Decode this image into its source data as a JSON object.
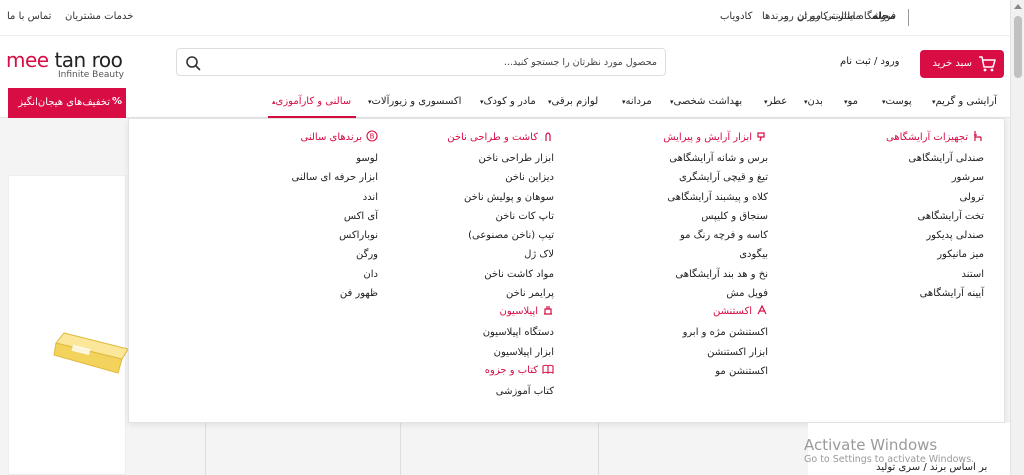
{
  "topbar": {
    "store_title": "فروشگاه اینترنتی مو تن رو",
    "magazine": "مجله",
    "user_content": "مطالب کاربران",
    "brands": "برندها",
    "cadoyab": "کادویاب",
    "customer_service": "خدمات مشتریان",
    "contact": "تماس با ما"
  },
  "header": {
    "logo_text": "tan roo",
    "logo_mee": "mee",
    "logo_sub": "Infinite Beauty",
    "search_placeholder": "محصول مورد نظرتان را جستجو کنید...",
    "login": "ورود / ثبت نام",
    "cart": "سبد خرید"
  },
  "nav": {
    "items": [
      "آرایشی و گریم",
      "پوست",
      "مو",
      "بدن",
      "عطر",
      "بهداشت شخصی",
      "مردانه",
      "لوازم برقی",
      "مادر و کودک",
      "اکسسوری و زیورآلات",
      "سالنی و کارآموزی"
    ],
    "deals": "تخفیف‌های هیجان‌انگیز",
    "deals_pct": "%"
  },
  "mega": {
    "columns": [
      {
        "groups": [
          {
            "head": "تجهیزات آرایشگاهی",
            "icon": "chair-icon",
            "links": [
              "صندلی آرایشگاهی",
              "سرشور",
              "ترولی",
              "تخت آرایشگاهی",
              "صندلی پدیکور",
              "میز مانیکور",
              "استند",
              "آیینه آرایشگاهی"
            ]
          }
        ]
      },
      {
        "groups": [
          {
            "head": "ابزار آرایش و پیرایش",
            "icon": "hairdryer-icon",
            "links": [
              "برس و شانه آرایشگاهی",
              "تیغ و قیچی آرایشگری",
              "کلاه و پیشبند آرایشگاهی",
              "سنجاق و کلیپس",
              "کاسه و فرچه رنگ مو",
              "بیگودی",
              "نخ و هد بند آرایشگاهی",
              "فویل مش"
            ]
          },
          {
            "head": "اکستنشن",
            "icon": "extension-icon",
            "links": [
              "اکستنشن مژه و ابرو",
              "ابزار اکستنشن",
              "اکستنشن مو"
            ]
          }
        ]
      },
      {
        "groups": [
          {
            "head": "کاشت و طراحی ناخن",
            "icon": "nail-icon",
            "links": [
              "ابزار طراحی ناخن",
              "دیزاین ناخن",
              "سوهان و پولیش ناخن",
              "تاپ کات ناخن",
              "تیپ (ناخن مصنوعی)",
              "لاک ژل",
              "مواد کاشت ناخن",
              "پرایمر ناخن"
            ]
          },
          {
            "head": "اپیلاسیون",
            "icon": "epilation-icon",
            "links": [
              "دستگاه اپیلاسیون",
              "ابزار اپیلاسیون"
            ]
          },
          {
            "head": "کتاب و جزوه",
            "icon": "book-icon",
            "links": [
              "کتاب آموزشی"
            ]
          }
        ]
      },
      {
        "groups": [
          {
            "head": "برندهای سالنی",
            "icon": "brand-icon",
            "links": [
              "لوسو",
              "ابزار حرفه ای سالنی",
              "اندد",
              "آی اکس",
              "نوباراکس",
              "ورگن",
              "دان",
              "ظهور فن"
            ]
          }
        ]
      }
    ]
  },
  "footer": {
    "watermark_title": "Activate Windows",
    "watermark_sub": "Go to Settings to activate Windows.",
    "sort_by": "بر اساس برند / سری تولید"
  },
  "colors": {
    "accent": "#d70d43"
  }
}
